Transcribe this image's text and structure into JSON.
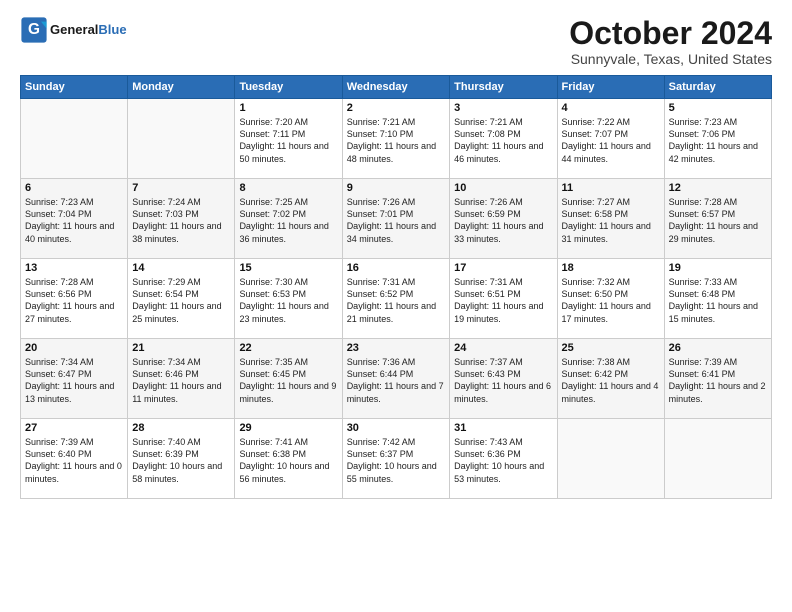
{
  "header": {
    "logo_general": "General",
    "logo_blue": "Blue",
    "month_title": "October 2024",
    "location": "Sunnyvale, Texas, United States"
  },
  "weekdays": [
    "Sunday",
    "Monday",
    "Tuesday",
    "Wednesday",
    "Thursday",
    "Friday",
    "Saturday"
  ],
  "weeks": [
    [
      {
        "day": "",
        "info": ""
      },
      {
        "day": "",
        "info": ""
      },
      {
        "day": "1",
        "info": "Sunrise: 7:20 AM\nSunset: 7:11 PM\nDaylight: 11 hours and 50 minutes."
      },
      {
        "day": "2",
        "info": "Sunrise: 7:21 AM\nSunset: 7:10 PM\nDaylight: 11 hours and 48 minutes."
      },
      {
        "day": "3",
        "info": "Sunrise: 7:21 AM\nSunset: 7:08 PM\nDaylight: 11 hours and 46 minutes."
      },
      {
        "day": "4",
        "info": "Sunrise: 7:22 AM\nSunset: 7:07 PM\nDaylight: 11 hours and 44 minutes."
      },
      {
        "day": "5",
        "info": "Sunrise: 7:23 AM\nSunset: 7:06 PM\nDaylight: 11 hours and 42 minutes."
      }
    ],
    [
      {
        "day": "6",
        "info": "Sunrise: 7:23 AM\nSunset: 7:04 PM\nDaylight: 11 hours and 40 minutes."
      },
      {
        "day": "7",
        "info": "Sunrise: 7:24 AM\nSunset: 7:03 PM\nDaylight: 11 hours and 38 minutes."
      },
      {
        "day": "8",
        "info": "Sunrise: 7:25 AM\nSunset: 7:02 PM\nDaylight: 11 hours and 36 minutes."
      },
      {
        "day": "9",
        "info": "Sunrise: 7:26 AM\nSunset: 7:01 PM\nDaylight: 11 hours and 34 minutes."
      },
      {
        "day": "10",
        "info": "Sunrise: 7:26 AM\nSunset: 6:59 PM\nDaylight: 11 hours and 33 minutes."
      },
      {
        "day": "11",
        "info": "Sunrise: 7:27 AM\nSunset: 6:58 PM\nDaylight: 11 hours and 31 minutes."
      },
      {
        "day": "12",
        "info": "Sunrise: 7:28 AM\nSunset: 6:57 PM\nDaylight: 11 hours and 29 minutes."
      }
    ],
    [
      {
        "day": "13",
        "info": "Sunrise: 7:28 AM\nSunset: 6:56 PM\nDaylight: 11 hours and 27 minutes."
      },
      {
        "day": "14",
        "info": "Sunrise: 7:29 AM\nSunset: 6:54 PM\nDaylight: 11 hours and 25 minutes."
      },
      {
        "day": "15",
        "info": "Sunrise: 7:30 AM\nSunset: 6:53 PM\nDaylight: 11 hours and 23 minutes."
      },
      {
        "day": "16",
        "info": "Sunrise: 7:31 AM\nSunset: 6:52 PM\nDaylight: 11 hours and 21 minutes."
      },
      {
        "day": "17",
        "info": "Sunrise: 7:31 AM\nSunset: 6:51 PM\nDaylight: 11 hours and 19 minutes."
      },
      {
        "day": "18",
        "info": "Sunrise: 7:32 AM\nSunset: 6:50 PM\nDaylight: 11 hours and 17 minutes."
      },
      {
        "day": "19",
        "info": "Sunrise: 7:33 AM\nSunset: 6:48 PM\nDaylight: 11 hours and 15 minutes."
      }
    ],
    [
      {
        "day": "20",
        "info": "Sunrise: 7:34 AM\nSunset: 6:47 PM\nDaylight: 11 hours and 13 minutes."
      },
      {
        "day": "21",
        "info": "Sunrise: 7:34 AM\nSunset: 6:46 PM\nDaylight: 11 hours and 11 minutes."
      },
      {
        "day": "22",
        "info": "Sunrise: 7:35 AM\nSunset: 6:45 PM\nDaylight: 11 hours and 9 minutes."
      },
      {
        "day": "23",
        "info": "Sunrise: 7:36 AM\nSunset: 6:44 PM\nDaylight: 11 hours and 7 minutes."
      },
      {
        "day": "24",
        "info": "Sunrise: 7:37 AM\nSunset: 6:43 PM\nDaylight: 11 hours and 6 minutes."
      },
      {
        "day": "25",
        "info": "Sunrise: 7:38 AM\nSunset: 6:42 PM\nDaylight: 11 hours and 4 minutes."
      },
      {
        "day": "26",
        "info": "Sunrise: 7:39 AM\nSunset: 6:41 PM\nDaylight: 11 hours and 2 minutes."
      }
    ],
    [
      {
        "day": "27",
        "info": "Sunrise: 7:39 AM\nSunset: 6:40 PM\nDaylight: 11 hours and 0 minutes."
      },
      {
        "day": "28",
        "info": "Sunrise: 7:40 AM\nSunset: 6:39 PM\nDaylight: 10 hours and 58 minutes."
      },
      {
        "day": "29",
        "info": "Sunrise: 7:41 AM\nSunset: 6:38 PM\nDaylight: 10 hours and 56 minutes."
      },
      {
        "day": "30",
        "info": "Sunrise: 7:42 AM\nSunset: 6:37 PM\nDaylight: 10 hours and 55 minutes."
      },
      {
        "day": "31",
        "info": "Sunrise: 7:43 AM\nSunset: 6:36 PM\nDaylight: 10 hours and 53 minutes."
      },
      {
        "day": "",
        "info": ""
      },
      {
        "day": "",
        "info": ""
      }
    ]
  ]
}
